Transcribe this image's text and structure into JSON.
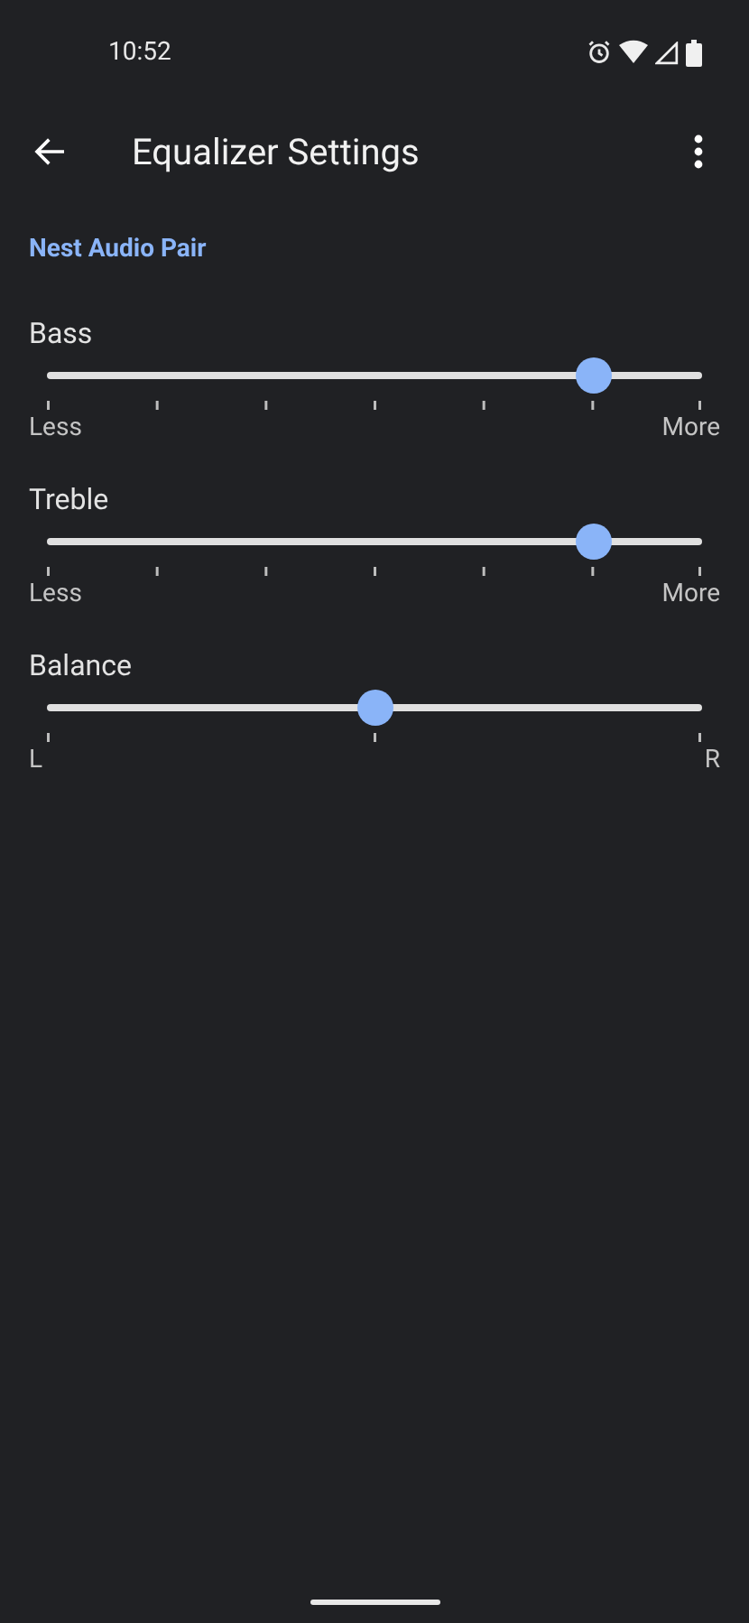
{
  "status_bar": {
    "time": "10:52"
  },
  "toolbar": {
    "title": "Equalizer Settings"
  },
  "section": {
    "title": "Nest Audio Pair"
  },
  "sliders": [
    {
      "kind": "eq",
      "label": "Bass",
      "level": 0.834,
      "min_label": "Less",
      "max_label": "More"
    },
    {
      "kind": "eq",
      "label": "Treble",
      "level": 0.834,
      "min_label": "Less",
      "max_label": "More"
    },
    {
      "kind": "balance",
      "label": "Balance",
      "level": 0.5,
      "min_label": "L",
      "max_label": "R"
    }
  ]
}
